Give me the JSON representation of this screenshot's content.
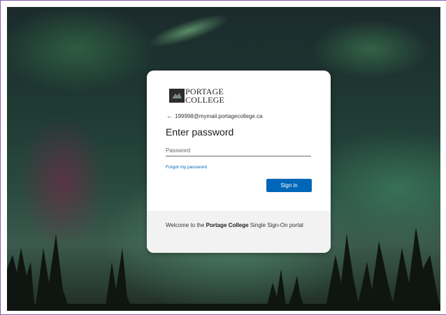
{
  "logo": {
    "line1": "PORTAGE",
    "line2": "COLLEGE"
  },
  "account": {
    "back_icon": "arrow-left-icon",
    "email": "199998@mymail.portagecollege.ca"
  },
  "form": {
    "title": "Enter password",
    "password_placeholder": "Password",
    "forgot_link": "Forgot my password",
    "signin_label": "Sign in"
  },
  "footer": {
    "prefix": "Welcome to the ",
    "brand": "Portage College",
    "suffix": " Single Sign-On portal"
  },
  "colors": {
    "accent": "#0067b8",
    "footer_bg": "#f2f2f2",
    "card_bg": "#ffffff"
  }
}
